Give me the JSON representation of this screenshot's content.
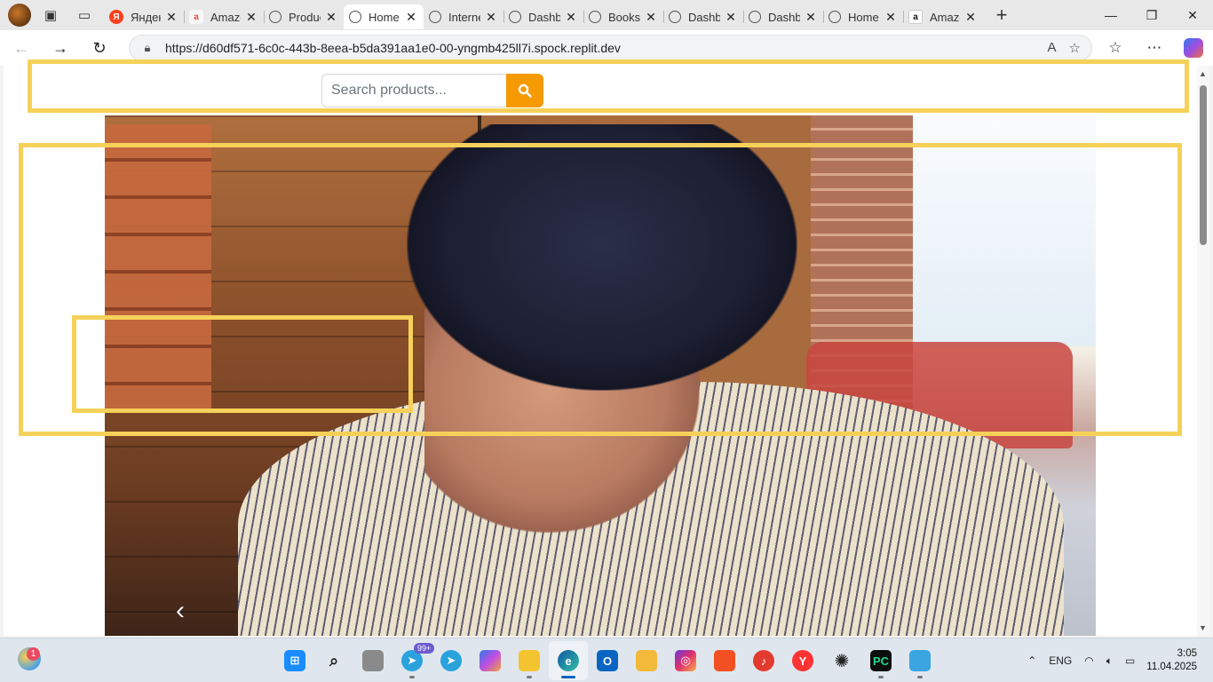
{
  "browser": {
    "tabs": [
      {
        "label": "Яндекс",
        "favicon": "yandex-icon",
        "active": false
      },
      {
        "label": "Amazon",
        "favicon": "amazon-icon",
        "active": false
      },
      {
        "label": "Products",
        "favicon": "globe-icon",
        "active": false
      },
      {
        "label": "Home",
        "favicon": "globe-icon",
        "active": true
      },
      {
        "label": "Internet",
        "favicon": "globe-icon",
        "active": false
      },
      {
        "label": "Dashboard",
        "favicon": "globe-icon",
        "active": false
      },
      {
        "label": "Books",
        "favicon": "globe-icon",
        "active": false
      },
      {
        "label": "Dashboard",
        "favicon": "globe-icon",
        "active": false
      },
      {
        "label": "Dashboard",
        "favicon": "globe-icon",
        "active": false
      },
      {
        "label": "Home",
        "favicon": "globe-icon",
        "active": false
      },
      {
        "label": "Amazon",
        "favicon": "amazon-icon",
        "active": false
      }
    ],
    "address": {
      "url": "https://d60df571-6c0c-443b-8eea-b5da391aa1e0-00-yngmb425ll7i.spock.replit.dev"
    }
  },
  "page": {
    "search": {
      "placeholder": "Search products..."
    },
    "colors": {
      "search_button": "#f59a00",
      "highlight": "#f6d15a"
    }
  },
  "taskbar": {
    "weather_badge": "1",
    "telegram_badge": "99+",
    "apps": [
      "start-icon",
      "search-icon",
      "task-view-icon",
      "telegram-icon",
      "telegram-icon",
      "copilot-icon",
      "file-explorer-icon",
      "edge-icon",
      "outlook-icon",
      "files-icon",
      "instagram-icon",
      "store-icon",
      "music-icon",
      "yandex-browser-icon",
      "chatgpt-icon",
      "pycharm-icon",
      "notepad-icon"
    ],
    "language": "ENG",
    "time": "3:05",
    "date": "11.04.2025"
  }
}
